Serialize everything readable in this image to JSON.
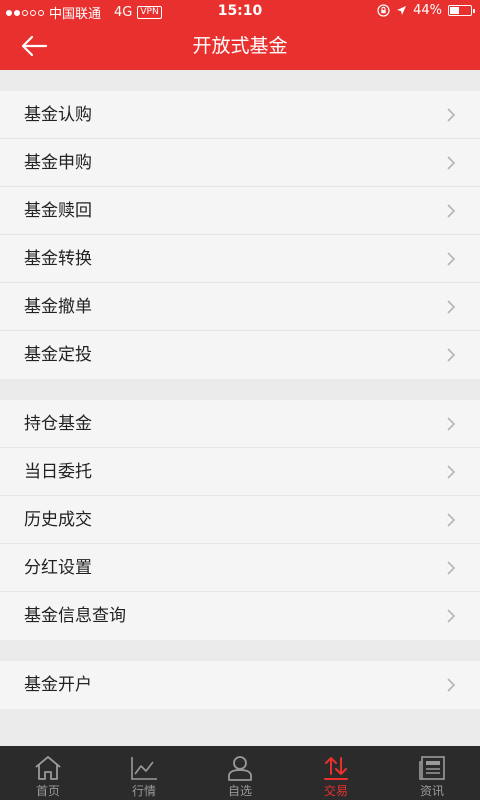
{
  "status_bar": {
    "carrier": "中国联通",
    "network": "4G",
    "vpn": "VPN",
    "time": "15:10",
    "battery": "44%",
    "battery_level": 0.44
  },
  "header": {
    "title": "开放式基金"
  },
  "sections": [
    {
      "items": [
        {
          "label": "基金认购"
        },
        {
          "label": "基金申购"
        },
        {
          "label": "基金赎回"
        },
        {
          "label": "基金转换"
        },
        {
          "label": "基金撤单"
        },
        {
          "label": "基金定投"
        }
      ]
    },
    {
      "items": [
        {
          "label": "持仓基金"
        },
        {
          "label": "当日委托"
        },
        {
          "label": "历史成交"
        },
        {
          "label": "分红设置"
        },
        {
          "label": "基金信息查询"
        }
      ]
    },
    {
      "items": [
        {
          "label": "基金开户"
        }
      ]
    }
  ],
  "tabbar": {
    "tabs": [
      {
        "label": "首页",
        "icon": "home-icon"
      },
      {
        "label": "行情",
        "icon": "chart-icon"
      },
      {
        "label": "自选",
        "icon": "user-icon"
      },
      {
        "label": "交易",
        "icon": "trade-arrows-icon",
        "active": true
      },
      {
        "label": "资讯",
        "icon": "news-icon"
      }
    ]
  },
  "colors": {
    "accent": "#e8312f",
    "tabbar_bg": "#2b2b2b",
    "tab_inactive": "#9a9a9a"
  }
}
